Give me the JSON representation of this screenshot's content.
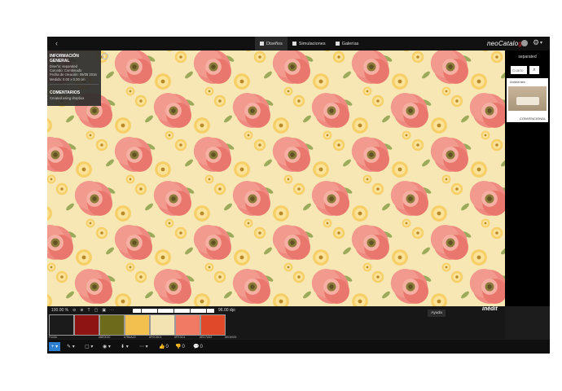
{
  "header": {
    "back_icon": "chevron-left",
    "tabs": [
      {
        "label": "Diseños",
        "icon": "grid-icon",
        "active": true
      },
      {
        "label": "Simulaciones",
        "icon": "image-icon",
        "active": false
      },
      {
        "label": "Galerías",
        "icon": "book-icon",
        "active": false
      }
    ],
    "brand": "neoCatalog",
    "user_icon": "avatar",
    "settings_icon": "gear-icon"
  },
  "info_panel": {
    "title": "INFORMACIÓN GENERAL",
    "lines": [
      "Diseño: separated",
      "Colorido: Combinado",
      "Fecha de creación: 06/05 2016",
      "Medida: 0.00 x 0.00 cm"
    ],
    "comments_title": "COMENTARIOS",
    "comment": "Created using dropbox",
    "close_icon": "info-icon"
  },
  "right_panel": {
    "title": "separated",
    "search_placeholder": "Cuarto",
    "card_label": "Ambientes",
    "card_tag": "CONVENCIONAL"
  },
  "strip": {
    "zoom": "100.00 %",
    "dpi": "96.00 dpi",
    "fondo_label": "Fondo",
    "swatches": [
      {
        "color": "#1b1b1b",
        "code": ""
      },
      {
        "color": "#8e1313",
        "code": "#8E0010"
      },
      {
        "color": "#6d6a1b",
        "code": "#7B6A22"
      },
      {
        "color": "#f2c04e",
        "code": "#F0C8C4"
      },
      {
        "color": "#f4e3b2",
        "code": "#FE3C4"
      },
      {
        "color": "#f07a63",
        "code": "#ED7A52"
      },
      {
        "color": "#e0492a",
        "code": "#E04925"
      }
    ]
  },
  "bottom": {
    "tools": [
      "+",
      "✎",
      "▢",
      "👁",
      "⬇",
      "⋯"
    ],
    "counts": [
      "0",
      "0",
      "0"
    ],
    "help": "Ayuda",
    "brand": "inédit"
  }
}
